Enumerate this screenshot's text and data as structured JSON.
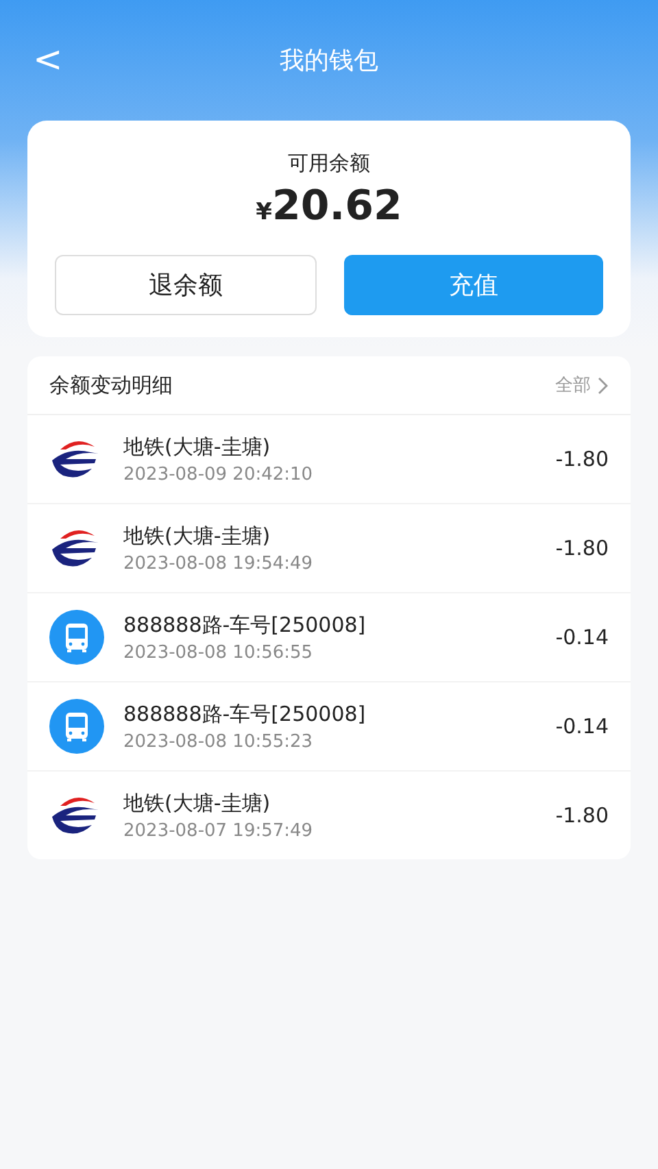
{
  "header": {
    "back": "<",
    "title": "我的钱包"
  },
  "balance": {
    "label": "可用余额",
    "currency": "¥",
    "amount": "20.62"
  },
  "buttons": [
    {
      "kind": "outline",
      "label": "退余额"
    },
    {
      "kind": "primary",
      "label": "充值"
    }
  ],
  "details": {
    "title": "余额变动明细",
    "more": "全部",
    "rows": [
      {
        "kind": "metro",
        "name": "地铁(大塘-圭塘)",
        "time": "2023-08-09 20:42:10",
        "amount": "-1.80"
      },
      {
        "kind": "metro",
        "name": "地铁(大塘-圭塘)",
        "time": "2023-08-08 19:54:49",
        "amount": "-1.80"
      },
      {
        "kind": "bus",
        "name": "888888路-车号[250008]",
        "time": "2023-08-08 10:56:55",
        "amount": "-0.14"
      },
      {
        "kind": "bus",
        "name": "888888路-车号[250008]",
        "time": "2023-08-08 10:55:23",
        "amount": "-0.14"
      },
      {
        "kind": "metro",
        "name": "地铁(大塘-圭塘)",
        "time": "2023-08-07 19:57:49",
        "amount": "-1.80"
      }
    ]
  }
}
